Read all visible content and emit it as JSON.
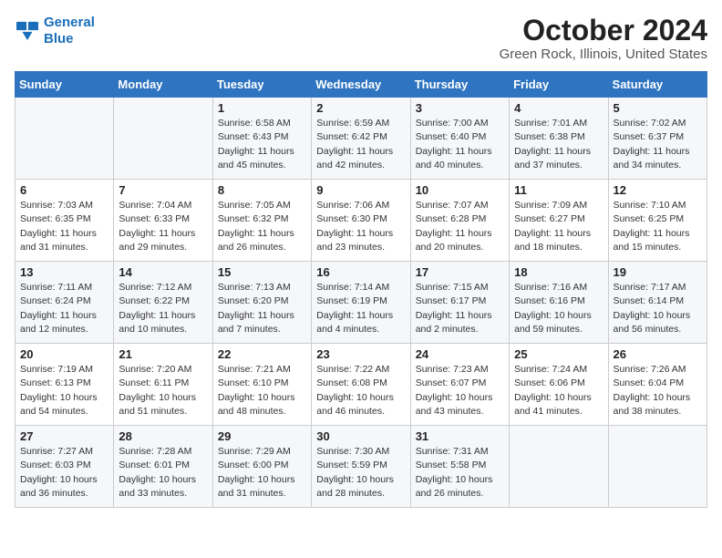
{
  "header": {
    "logo_line1": "General",
    "logo_line2": "Blue",
    "month": "October 2024",
    "location": "Green Rock, Illinois, United States"
  },
  "days_of_week": [
    "Sunday",
    "Monday",
    "Tuesday",
    "Wednesday",
    "Thursday",
    "Friday",
    "Saturday"
  ],
  "weeks": [
    [
      {
        "day": "",
        "sunrise": "",
        "sunset": "",
        "daylight": ""
      },
      {
        "day": "",
        "sunrise": "",
        "sunset": "",
        "daylight": ""
      },
      {
        "day": "1",
        "sunrise": "Sunrise: 6:58 AM",
        "sunset": "Sunset: 6:43 PM",
        "daylight": "Daylight: 11 hours and 45 minutes."
      },
      {
        "day": "2",
        "sunrise": "Sunrise: 6:59 AM",
        "sunset": "Sunset: 6:42 PM",
        "daylight": "Daylight: 11 hours and 42 minutes."
      },
      {
        "day": "3",
        "sunrise": "Sunrise: 7:00 AM",
        "sunset": "Sunset: 6:40 PM",
        "daylight": "Daylight: 11 hours and 40 minutes."
      },
      {
        "day": "4",
        "sunrise": "Sunrise: 7:01 AM",
        "sunset": "Sunset: 6:38 PM",
        "daylight": "Daylight: 11 hours and 37 minutes."
      },
      {
        "day": "5",
        "sunrise": "Sunrise: 7:02 AM",
        "sunset": "Sunset: 6:37 PM",
        "daylight": "Daylight: 11 hours and 34 minutes."
      }
    ],
    [
      {
        "day": "6",
        "sunrise": "Sunrise: 7:03 AM",
        "sunset": "Sunset: 6:35 PM",
        "daylight": "Daylight: 11 hours and 31 minutes."
      },
      {
        "day": "7",
        "sunrise": "Sunrise: 7:04 AM",
        "sunset": "Sunset: 6:33 PM",
        "daylight": "Daylight: 11 hours and 29 minutes."
      },
      {
        "day": "8",
        "sunrise": "Sunrise: 7:05 AM",
        "sunset": "Sunset: 6:32 PM",
        "daylight": "Daylight: 11 hours and 26 minutes."
      },
      {
        "day": "9",
        "sunrise": "Sunrise: 7:06 AM",
        "sunset": "Sunset: 6:30 PM",
        "daylight": "Daylight: 11 hours and 23 minutes."
      },
      {
        "day": "10",
        "sunrise": "Sunrise: 7:07 AM",
        "sunset": "Sunset: 6:28 PM",
        "daylight": "Daylight: 11 hours and 20 minutes."
      },
      {
        "day": "11",
        "sunrise": "Sunrise: 7:09 AM",
        "sunset": "Sunset: 6:27 PM",
        "daylight": "Daylight: 11 hours and 18 minutes."
      },
      {
        "day": "12",
        "sunrise": "Sunrise: 7:10 AM",
        "sunset": "Sunset: 6:25 PM",
        "daylight": "Daylight: 11 hours and 15 minutes."
      }
    ],
    [
      {
        "day": "13",
        "sunrise": "Sunrise: 7:11 AM",
        "sunset": "Sunset: 6:24 PM",
        "daylight": "Daylight: 11 hours and 12 minutes."
      },
      {
        "day": "14",
        "sunrise": "Sunrise: 7:12 AM",
        "sunset": "Sunset: 6:22 PM",
        "daylight": "Daylight: 11 hours and 10 minutes."
      },
      {
        "day": "15",
        "sunrise": "Sunrise: 7:13 AM",
        "sunset": "Sunset: 6:20 PM",
        "daylight": "Daylight: 11 hours and 7 minutes."
      },
      {
        "day": "16",
        "sunrise": "Sunrise: 7:14 AM",
        "sunset": "Sunset: 6:19 PM",
        "daylight": "Daylight: 11 hours and 4 minutes."
      },
      {
        "day": "17",
        "sunrise": "Sunrise: 7:15 AM",
        "sunset": "Sunset: 6:17 PM",
        "daylight": "Daylight: 11 hours and 2 minutes."
      },
      {
        "day": "18",
        "sunrise": "Sunrise: 7:16 AM",
        "sunset": "Sunset: 6:16 PM",
        "daylight": "Daylight: 10 hours and 59 minutes."
      },
      {
        "day": "19",
        "sunrise": "Sunrise: 7:17 AM",
        "sunset": "Sunset: 6:14 PM",
        "daylight": "Daylight: 10 hours and 56 minutes."
      }
    ],
    [
      {
        "day": "20",
        "sunrise": "Sunrise: 7:19 AM",
        "sunset": "Sunset: 6:13 PM",
        "daylight": "Daylight: 10 hours and 54 minutes."
      },
      {
        "day": "21",
        "sunrise": "Sunrise: 7:20 AM",
        "sunset": "Sunset: 6:11 PM",
        "daylight": "Daylight: 10 hours and 51 minutes."
      },
      {
        "day": "22",
        "sunrise": "Sunrise: 7:21 AM",
        "sunset": "Sunset: 6:10 PM",
        "daylight": "Daylight: 10 hours and 48 minutes."
      },
      {
        "day": "23",
        "sunrise": "Sunrise: 7:22 AM",
        "sunset": "Sunset: 6:08 PM",
        "daylight": "Daylight: 10 hours and 46 minutes."
      },
      {
        "day": "24",
        "sunrise": "Sunrise: 7:23 AM",
        "sunset": "Sunset: 6:07 PM",
        "daylight": "Daylight: 10 hours and 43 minutes."
      },
      {
        "day": "25",
        "sunrise": "Sunrise: 7:24 AM",
        "sunset": "Sunset: 6:06 PM",
        "daylight": "Daylight: 10 hours and 41 minutes."
      },
      {
        "day": "26",
        "sunrise": "Sunrise: 7:26 AM",
        "sunset": "Sunset: 6:04 PM",
        "daylight": "Daylight: 10 hours and 38 minutes."
      }
    ],
    [
      {
        "day": "27",
        "sunrise": "Sunrise: 7:27 AM",
        "sunset": "Sunset: 6:03 PM",
        "daylight": "Daylight: 10 hours and 36 minutes."
      },
      {
        "day": "28",
        "sunrise": "Sunrise: 7:28 AM",
        "sunset": "Sunset: 6:01 PM",
        "daylight": "Daylight: 10 hours and 33 minutes."
      },
      {
        "day": "29",
        "sunrise": "Sunrise: 7:29 AM",
        "sunset": "Sunset: 6:00 PM",
        "daylight": "Daylight: 10 hours and 31 minutes."
      },
      {
        "day": "30",
        "sunrise": "Sunrise: 7:30 AM",
        "sunset": "Sunset: 5:59 PM",
        "daylight": "Daylight: 10 hours and 28 minutes."
      },
      {
        "day": "31",
        "sunrise": "Sunrise: 7:31 AM",
        "sunset": "Sunset: 5:58 PM",
        "daylight": "Daylight: 10 hours and 26 minutes."
      },
      {
        "day": "",
        "sunrise": "",
        "sunset": "",
        "daylight": ""
      },
      {
        "day": "",
        "sunrise": "",
        "sunset": "",
        "daylight": ""
      }
    ]
  ]
}
